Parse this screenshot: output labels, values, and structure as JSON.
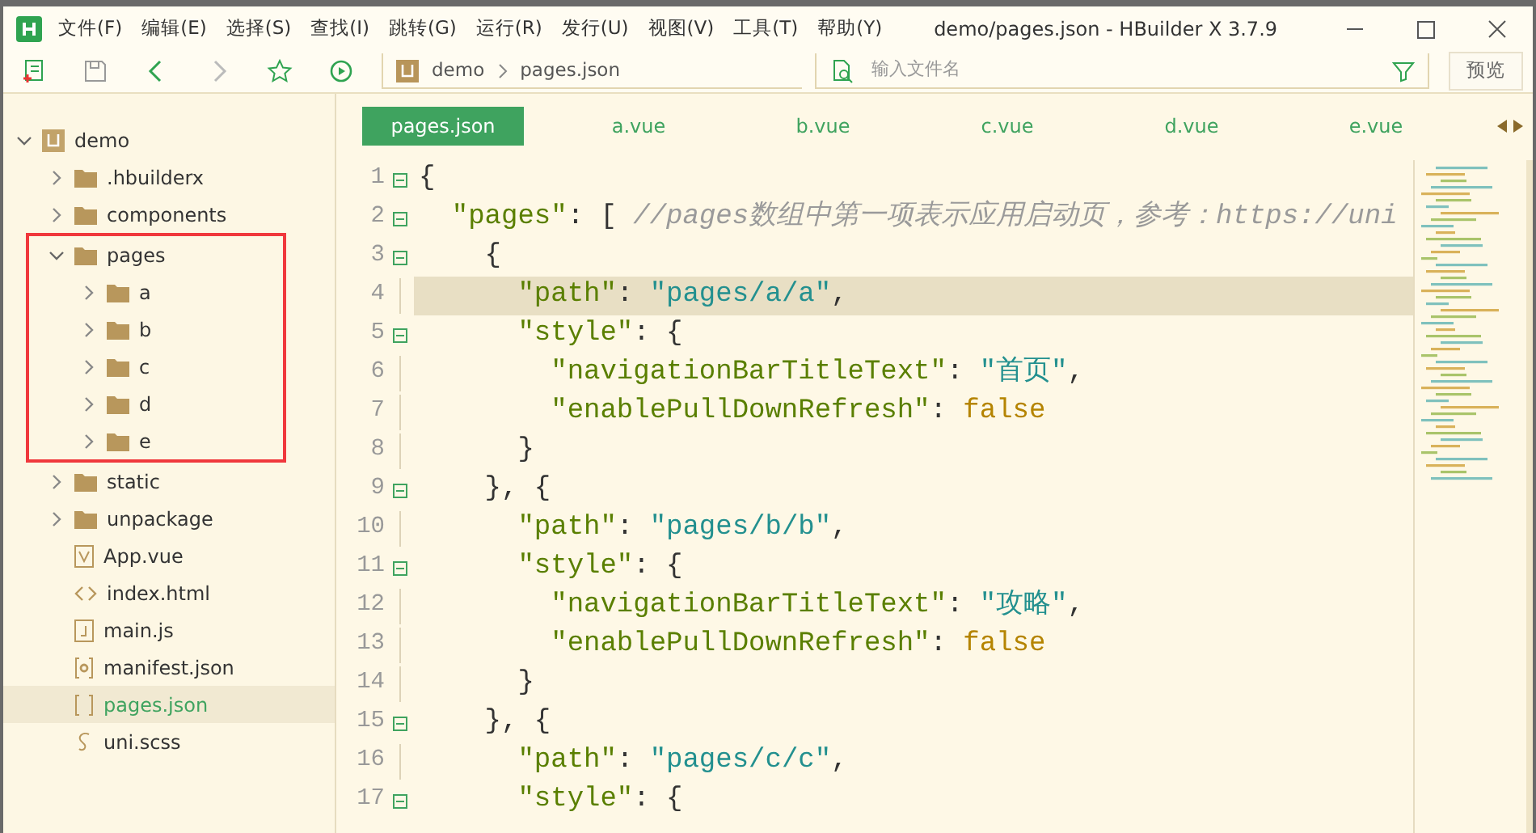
{
  "window": {
    "title": "demo/pages.json - HBuilder X 3.7.9"
  },
  "menu": [
    "文件(F)",
    "编辑(E)",
    "选择(S)",
    "查找(I)",
    "跳转(G)",
    "运行(R)",
    "发行(U)",
    "视图(V)",
    "工具(T)",
    "帮助(Y)"
  ],
  "breadcrumb": [
    "demo",
    "pages.json"
  ],
  "file_search": {
    "placeholder": "输入文件名"
  },
  "preview_button": "预览",
  "tree": [
    {
      "label": "demo",
      "kind": "project",
      "expanded": true,
      "selected": false,
      "outlined": false,
      "children": [
        {
          "label": ".hbuilderx",
          "kind": "folder",
          "expanded": false,
          "selected": false,
          "outlined": false
        },
        {
          "label": "components",
          "kind": "folder",
          "expanded": false,
          "selected": false,
          "outlined": false
        },
        {
          "label": "pages",
          "kind": "folder",
          "expanded": true,
          "selected": false,
          "outlined": true,
          "children": [
            {
              "label": "a",
              "kind": "folder",
              "expanded": false,
              "selected": false,
              "outlined": false
            },
            {
              "label": "b",
              "kind": "folder",
              "expanded": false,
              "selected": false,
              "outlined": false
            },
            {
              "label": "c",
              "kind": "folder",
              "expanded": false,
              "selected": false,
              "outlined": false
            },
            {
              "label": "d",
              "kind": "folder",
              "expanded": false,
              "selected": false,
              "outlined": false
            },
            {
              "label": "e",
              "kind": "folder",
              "expanded": false,
              "selected": false,
              "outlined": false
            }
          ]
        },
        {
          "label": "static",
          "kind": "folder",
          "expanded": false,
          "selected": false,
          "outlined": false
        },
        {
          "label": "unpackage",
          "kind": "folder",
          "expanded": false,
          "selected": false,
          "outlined": false
        },
        {
          "label": "App.vue",
          "kind": "vue",
          "selected": false,
          "outlined": false
        },
        {
          "label": "index.html",
          "kind": "html",
          "selected": false,
          "outlined": false
        },
        {
          "label": "main.js",
          "kind": "js",
          "selected": false,
          "outlined": false
        },
        {
          "label": "manifest.json",
          "kind": "manifest",
          "selected": false,
          "outlined": false
        },
        {
          "label": "pages.json",
          "kind": "json",
          "selected": true,
          "outlined": false
        },
        {
          "label": "uni.scss",
          "kind": "scss",
          "selected": false,
          "outlined": false
        }
      ]
    }
  ],
  "tabs": [
    {
      "label": "pages.json",
      "selected": true
    },
    {
      "label": "a.vue",
      "selected": false
    },
    {
      "label": "b.vue",
      "selected": false
    },
    {
      "label": "c.vue",
      "selected": false
    },
    {
      "label": "d.vue",
      "selected": false
    },
    {
      "label": "e.vue",
      "selected": false
    }
  ],
  "code": [
    {
      "n": "1",
      "fold": true,
      "current": false,
      "tokens": [
        {
          "kind": "punct",
          "text": "{"
        }
      ]
    },
    {
      "n": "2",
      "fold": true,
      "current": false,
      "tokens": [
        {
          "kind": "key",
          "text": "  \"pages\""
        },
        {
          "kind": "punct",
          "text": ": [ "
        },
        {
          "kind": "comment",
          "text": "//pages数组中第一项表示应用启动页，参考：https://uni"
        }
      ]
    },
    {
      "n": "3",
      "fold": true,
      "current": false,
      "tokens": [
        {
          "kind": "punct",
          "text": "    {"
        }
      ]
    },
    {
      "n": "4",
      "fold": false,
      "current": true,
      "tokens": [
        {
          "kind": "key",
          "text": "      \"path\""
        },
        {
          "kind": "punct",
          "text": ": "
        },
        {
          "kind": "string",
          "text": "\"pages/a/a\""
        },
        {
          "kind": "punct",
          "text": ","
        }
      ]
    },
    {
      "n": "5",
      "fold": true,
      "current": false,
      "tokens": [
        {
          "kind": "key",
          "text": "      \"style\""
        },
        {
          "kind": "punct",
          "text": ": {"
        }
      ]
    },
    {
      "n": "6",
      "fold": false,
      "current": false,
      "tokens": [
        {
          "kind": "key",
          "text": "        \"navigationBarTitleText\""
        },
        {
          "kind": "punct",
          "text": ": "
        },
        {
          "kind": "string",
          "text": "\"首页\""
        },
        {
          "kind": "punct",
          "text": ","
        }
      ]
    },
    {
      "n": "7",
      "fold": false,
      "current": false,
      "tokens": [
        {
          "kind": "key",
          "text": "        \"enablePullDownRefresh\""
        },
        {
          "kind": "punct",
          "text": ": "
        },
        {
          "kind": "bool",
          "text": "false"
        }
      ]
    },
    {
      "n": "8",
      "fold": false,
      "current": false,
      "tokens": [
        {
          "kind": "punct",
          "text": "      }"
        }
      ]
    },
    {
      "n": "9",
      "fold": true,
      "current": false,
      "tokens": [
        {
          "kind": "punct",
          "text": "    }, {"
        }
      ]
    },
    {
      "n": "10",
      "fold": false,
      "current": false,
      "tokens": [
        {
          "kind": "key",
          "text": "      \"path\""
        },
        {
          "kind": "punct",
          "text": ": "
        },
        {
          "kind": "string",
          "text": "\"pages/b/b\""
        },
        {
          "kind": "punct",
          "text": ","
        }
      ]
    },
    {
      "n": "11",
      "fold": true,
      "current": false,
      "tokens": [
        {
          "kind": "key",
          "text": "      \"style\""
        },
        {
          "kind": "punct",
          "text": ": {"
        }
      ]
    },
    {
      "n": "12",
      "fold": false,
      "current": false,
      "tokens": [
        {
          "kind": "key",
          "text": "        \"navigationBarTitleText\""
        },
        {
          "kind": "punct",
          "text": ": "
        },
        {
          "kind": "string",
          "text": "\"攻略\""
        },
        {
          "kind": "punct",
          "text": ","
        }
      ]
    },
    {
      "n": "13",
      "fold": false,
      "current": false,
      "tokens": [
        {
          "kind": "key",
          "text": "        \"enablePullDownRefresh\""
        },
        {
          "kind": "punct",
          "text": ": "
        },
        {
          "kind": "bool",
          "text": "false"
        }
      ]
    },
    {
      "n": "14",
      "fold": false,
      "current": false,
      "tokens": [
        {
          "kind": "punct",
          "text": "      }"
        }
      ]
    },
    {
      "n": "15",
      "fold": true,
      "current": false,
      "tokens": [
        {
          "kind": "punct",
          "text": "    }, {"
        }
      ]
    },
    {
      "n": "16",
      "fold": false,
      "current": false,
      "tokens": [
        {
          "kind": "key",
          "text": "      \"path\""
        },
        {
          "kind": "punct",
          "text": ": "
        },
        {
          "kind": "string",
          "text": "\"pages/c/c\""
        },
        {
          "kind": "punct",
          "text": ","
        }
      ]
    },
    {
      "n": "17",
      "fold": true,
      "current": false,
      "tokens": [
        {
          "kind": "key",
          "text": "      \"style\""
        },
        {
          "kind": "punct",
          "text": ": {"
        }
      ]
    }
  ]
}
